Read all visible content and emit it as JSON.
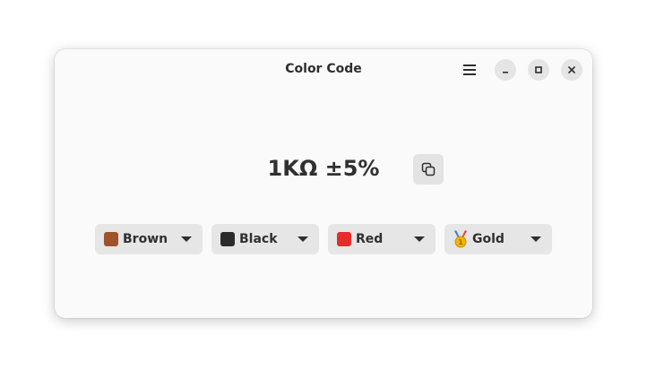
{
  "window": {
    "title": "Color Code"
  },
  "result": {
    "value": "1KΩ ±5%"
  },
  "bands": [
    {
      "label": "Brown",
      "color": "#a0522d",
      "icon": "brown-square-icon"
    },
    {
      "label": "Black",
      "color": "#2b2b2b",
      "icon": "black-square-icon"
    },
    {
      "label": "Red",
      "color": "#e52b2b",
      "icon": "red-square-icon"
    },
    {
      "label": "Gold",
      "color": "#f2b705",
      "icon": "gold-medal-icon"
    }
  ],
  "colors": {
    "window_bg": "#fafafa",
    "button_bg": "#e6e6e6",
    "text": "#303030"
  }
}
